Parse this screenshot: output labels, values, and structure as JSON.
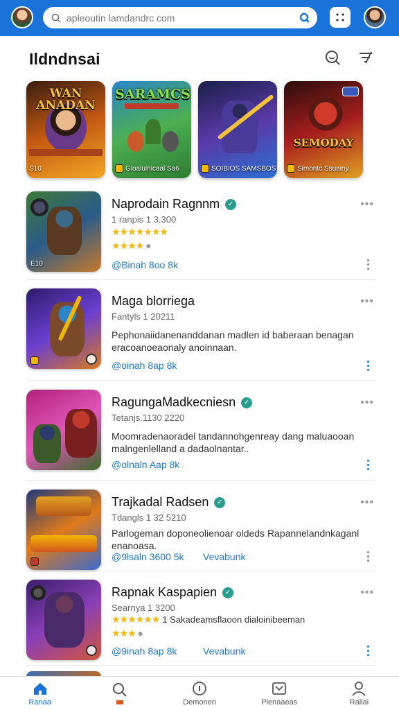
{
  "search": {
    "placeholder": "apleoutin lamdandrc com"
  },
  "header": {
    "title": "Ildndnsai"
  },
  "featured": [
    {
      "title": "WAN ANADAN",
      "subtitle": "S10",
      "colors": [
        "#3a1d0f",
        "#c45a12",
        "#f2a623"
      ],
      "title_color": "#f7c23a"
    },
    {
      "title": "SARAMCS",
      "subtitle": "Gioaluinicaal Sa6",
      "colors": [
        "#2a86c9",
        "#4caf50",
        "#2e7d32"
      ],
      "title_color": "#8be04a"
    },
    {
      "title": "",
      "subtitle": "SOIBIOS SAMSBOS",
      "colors": [
        "#1b1f4a",
        "#5a3aa8",
        "#2b6fd1"
      ],
      "title_color": "#ffffff"
    },
    {
      "title": "SEMODAY",
      "subtitle": "Simontc Ssuainy",
      "colors": [
        "#2a0d0a",
        "#a81f1f",
        "#e0a020"
      ],
      "title_color": "#f1c23a"
    }
  ],
  "apps": [
    {
      "name": "Naprodain Ragnnm",
      "meta": "1 ranpis 1 3.300",
      "stars_line1": "★★★★★★★",
      "stars_line2": "★★★★",
      "desc": "",
      "link": "@Binah 8oo 8k",
      "link2": "",
      "thumb_tag": "E10",
      "colors": [
        "#3c7a3a",
        "#2b5c8a",
        "#c97a2a"
      ]
    },
    {
      "name": "Maga blorriega",
      "meta": "Fantyls 1 20211",
      "stars_line1": "",
      "stars_line2": "",
      "desc": "Pephonaiidanenanddanan madlen id baberaan benagan eracoanoeaonaly anoinnaan.",
      "link": "@oinah 8ap 8k",
      "link2": "",
      "thumb_tag": "",
      "colors": [
        "#2d1c6b",
        "#6b3fd1",
        "#d67a1f"
      ]
    },
    {
      "name": "RagungaMadkecniesn",
      "meta": "Tetanjs.1130 2220",
      "stars_line1": "",
      "stars_line2": "",
      "desc": "Moomradenaoradel tandannohgenreay dang maluaooan malngenlelland a dadaolnantar..",
      "link": "@olnaln Aap 8k",
      "link2": "",
      "thumb_tag": "",
      "colors": [
        "#b0237a",
        "#e055b8",
        "#3a6b2a"
      ]
    },
    {
      "name": "Trajkadal Radsen",
      "meta": "Tdangls 1 32 5210",
      "stars_line1": "",
      "stars_line2": "",
      "desc": "Parlogeman doponeolienoar oldeds Rapannelandnkaganl enanoasa.",
      "link": "@9lsaln 3600 5k",
      "link2": "Vevabunk",
      "thumb_tag": "",
      "colors": [
        "#1e3a7a",
        "#e07a1a",
        "#3b6bcc"
      ]
    },
    {
      "name": "Rapnak Kaspapien",
      "meta": "Searnya 1 3200",
      "stars_line1": "★★★★★★",
      "stars_line2": "★★★",
      "desc": "",
      "inline_text": "1 Sakadeamsflaoon dialoinibeeman",
      "link": "@9inah 8ap 8k",
      "link2": "Vevabunk",
      "thumb_tag": "",
      "colors": [
        "#3a1f6b",
        "#8a3fb8",
        "#d1553a"
      ]
    }
  ],
  "nav": [
    {
      "label": "Ranaa",
      "icon": "home-icon",
      "active": true
    },
    {
      "label": "",
      "icon": "search-icon",
      "active": false
    },
    {
      "label": "Demoneri",
      "icon": "info-icon",
      "active": false
    },
    {
      "label": "Plenaaeas",
      "icon": "inbox-icon",
      "active": false
    },
    {
      "label": "Rallai",
      "icon": "profile-icon",
      "active": false
    }
  ],
  "colors": {
    "brand_blue": "#1a73d9",
    "link": "#1f78d1",
    "star": "#f2b705",
    "verified": "#2a9d8f"
  }
}
